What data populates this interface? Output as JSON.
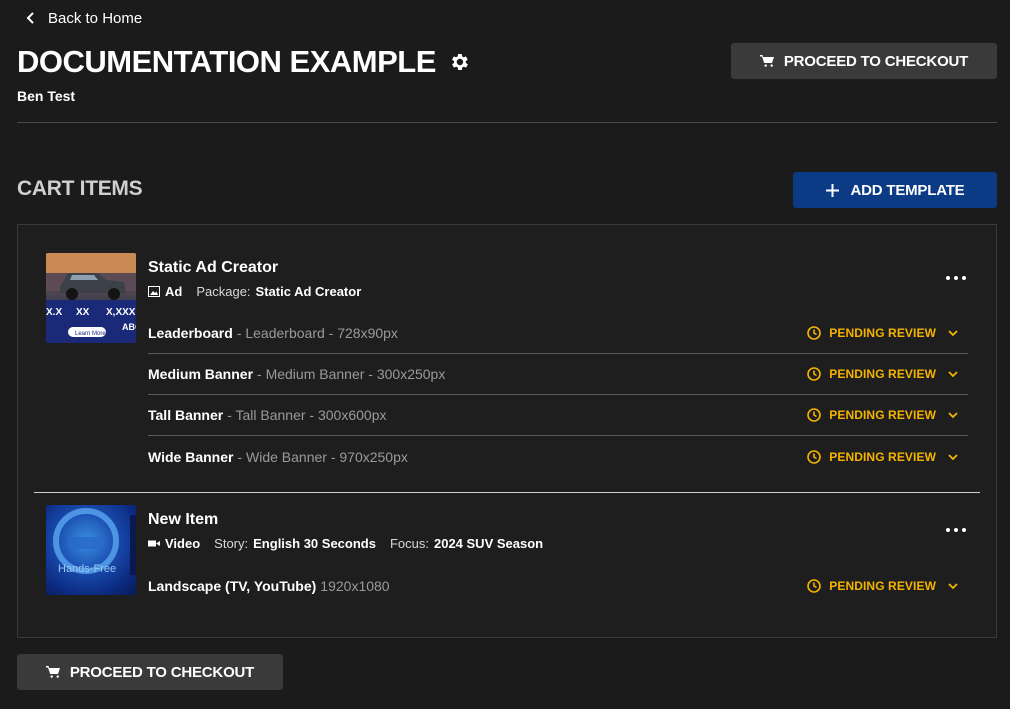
{
  "nav": {
    "back_label": "Back to Home"
  },
  "header": {
    "title": "DOCUMENTATION EXAMPLE",
    "subtitle": "Ben Test",
    "checkout_label": "PROCEED TO CHECKOUT"
  },
  "cart": {
    "section_title": "CART ITEMS",
    "add_template_label": "ADD TEMPLATE",
    "items": [
      {
        "title": "Static Ad Creator",
        "type_label": "Ad",
        "package_key": "Package:",
        "package_value": "Static Ad Creator",
        "lines": [
          {
            "name": "Leaderboard",
            "detail": "- Leaderboard - 728x90px",
            "status": "PENDING REVIEW"
          },
          {
            "name": "Medium Banner",
            "detail": "- Medium Banner - 300x250px",
            "status": "PENDING REVIEW"
          },
          {
            "name": "Tall Banner",
            "detail": "- Tall Banner - 300x600px",
            "status": "PENDING REVIEW"
          },
          {
            "name": "Wide Banner",
            "detail": "- Wide Banner - 970x250px",
            "status": "PENDING REVIEW"
          }
        ]
      },
      {
        "title": "New Item",
        "type_label": "Video",
        "story_key": "Story:",
        "story_value": "English 30 Seconds",
        "focus_key": "Focus:",
        "focus_value": "2024 SUV Season",
        "lines": [
          {
            "name": "Landscape (TV, YouTube)",
            "detail": "1920x1080",
            "status": "PENDING REVIEW"
          }
        ]
      }
    ]
  },
  "footer": {
    "checkout_label": "PROCEED TO CHECKOUT"
  },
  "thumbnails": {
    "ad_price_text": "X.X",
    "ad_price_text_2": "XX",
    "ad_price_text_3": "X,XXX",
    "ad_cta": "Learn More",
    "ad_brand": "ABC",
    "video_text": "Hands-Free"
  },
  "colors": {
    "background": "#1b1b1b",
    "accent_blue": "#0a3b84",
    "status_yellow": "#f5b400",
    "button_gray": "#3a3a3a"
  },
  "icons": {
    "back": "chevron-left-icon",
    "settings": "gear-icon",
    "cart": "cart-icon",
    "add": "plus-icon",
    "more": "more-horizontal-icon",
    "status": "clock-icon",
    "expand": "chevron-down-icon",
    "ad_type": "image-icon",
    "video_type": "video-camera-icon"
  }
}
